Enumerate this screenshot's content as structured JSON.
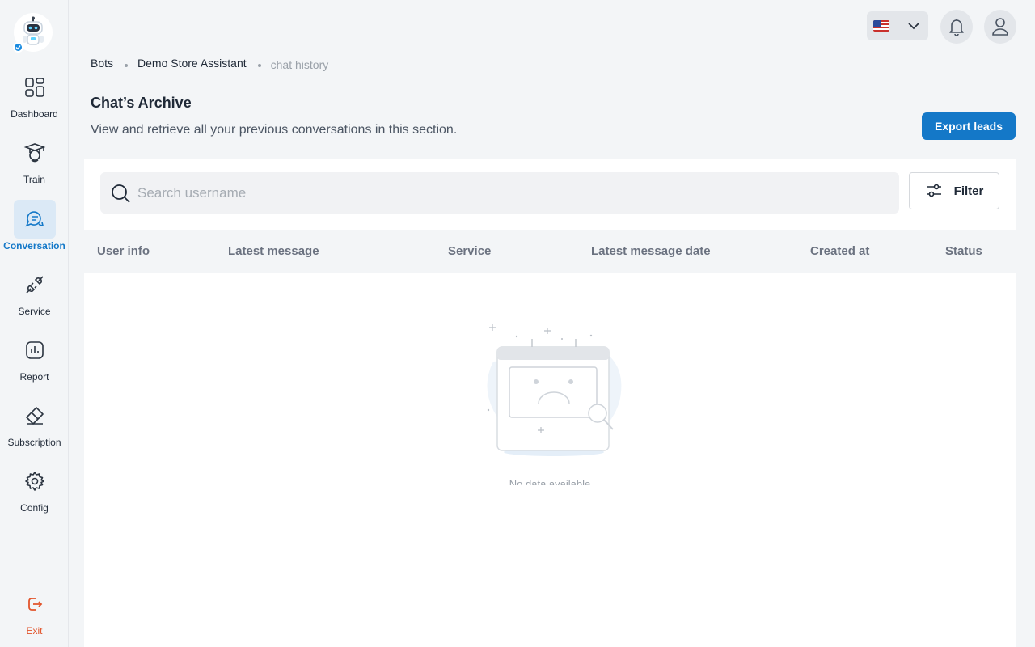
{
  "app": {
    "nav": [
      {
        "label": "Dashboard",
        "icon": "grid-icon",
        "active": false
      },
      {
        "label": "Train",
        "icon": "graduation-icon",
        "active": false
      },
      {
        "label": "Conversation",
        "icon": "chat-icon",
        "active": true
      },
      {
        "label": "Service",
        "icon": "plug-icon",
        "active": false
      },
      {
        "label": "Report",
        "icon": "report-icon",
        "active": false
      },
      {
        "label": "Subscription",
        "icon": "ticket-icon",
        "active": false
      },
      {
        "label": "Config",
        "icon": "gear-icon",
        "active": false
      }
    ],
    "exit_label": "Exit"
  },
  "topbar": {
    "language_flag": "us-flag-icon"
  },
  "breadcrumb": [
    "Bots",
    "Demo Store Assistant",
    "chat history"
  ],
  "page": {
    "title": "Chat’s Archive",
    "subtitle": "View and retrieve all your previous conversations in this section.",
    "export_label": "Export leads"
  },
  "search": {
    "placeholder": "Search username",
    "value": ""
  },
  "filter_label": "Filter",
  "table": {
    "columns": [
      "User info",
      "Latest message",
      "Service",
      "Latest message date",
      "Created at",
      "Status"
    ],
    "rows": [],
    "empty_text": "No data available"
  },
  "colors": {
    "accent": "#1478c8",
    "exit": "#e2542b",
    "active_bg": "#dbe9f6"
  }
}
